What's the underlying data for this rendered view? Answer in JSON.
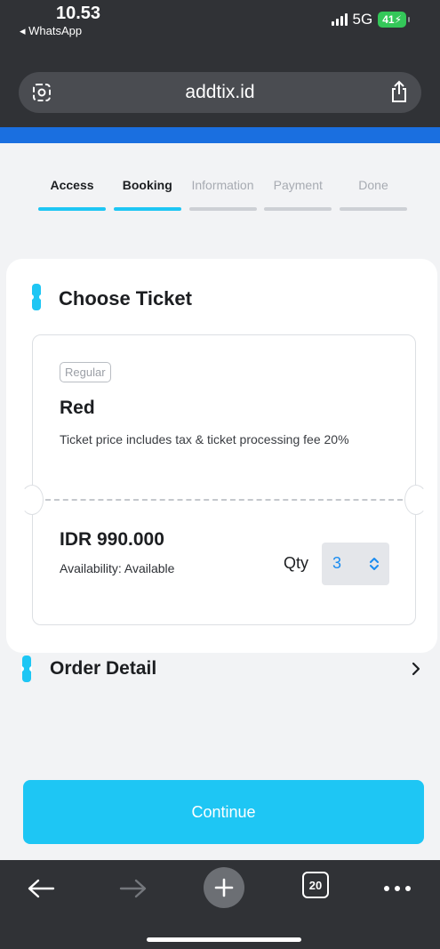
{
  "status": {
    "time": "10.53",
    "back_app": "◂ WhatsApp",
    "network": "5G",
    "battery": "41"
  },
  "browser": {
    "url": "addtix.id",
    "tabs_count": "20"
  },
  "steps": [
    {
      "label": "Access",
      "active": true
    },
    {
      "label": "Booking",
      "active": true
    },
    {
      "label": "Information",
      "active": false
    },
    {
      "label": "Payment",
      "active": false
    },
    {
      "label": "Done",
      "active": false
    }
  ],
  "choose_ticket": {
    "title": "Choose Ticket",
    "ticket": {
      "category": "Regular",
      "name": "Red",
      "description": "Ticket price includes tax & ticket processing fee 20%",
      "price": "IDR 990.000",
      "availability": "Availability: Available",
      "qty_label": "Qty",
      "qty_value": "3"
    }
  },
  "order_detail": {
    "title": "Order Detail"
  },
  "continue_label": "Continue",
  "colors": {
    "accent": "#1ec6f4",
    "brand_blue": "#1a6fe0",
    "inactive_step": "#cdd0d5",
    "browser_chrome": "#303236"
  }
}
